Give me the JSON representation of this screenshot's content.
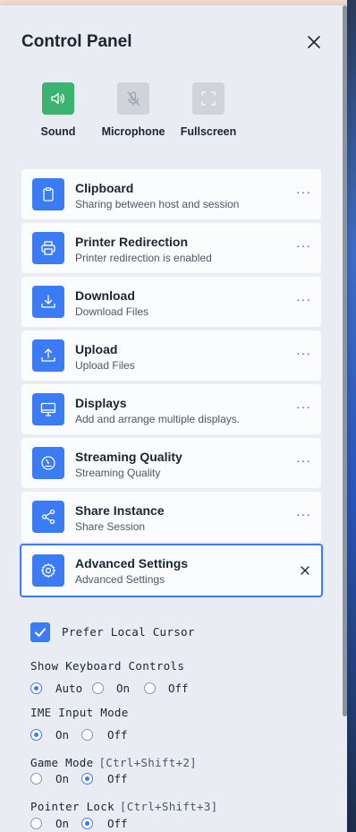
{
  "panel": {
    "title": "Control Panel"
  },
  "quick_actions": [
    {
      "label": "Sound",
      "icon": "speaker-icon",
      "active": true
    },
    {
      "label": "Microphone",
      "icon": "microphone-muted-icon",
      "active": false
    },
    {
      "label": "Fullscreen",
      "icon": "fullscreen-icon",
      "active": false
    }
  ],
  "items": [
    {
      "title": "Clipboard",
      "subtitle": "Sharing between host and session",
      "icon": "clipboard-icon"
    },
    {
      "title": "Printer Redirection",
      "subtitle": "Printer redirection is enabled",
      "icon": "printer-icon"
    },
    {
      "title": "Download",
      "subtitle": "Download Files",
      "icon": "download-icon"
    },
    {
      "title": "Upload",
      "subtitle": "Upload Files",
      "icon": "upload-icon"
    },
    {
      "title": "Displays",
      "subtitle": "Add and arrange multiple displays.",
      "icon": "monitor-icon"
    },
    {
      "title": "Streaming Quality",
      "subtitle": "Streaming Quality",
      "icon": "speedometer-icon"
    },
    {
      "title": "Share Instance",
      "subtitle": "Share Session",
      "icon": "share-icon"
    },
    {
      "title": "Advanced Settings",
      "subtitle": "Advanced Settings",
      "icon": "gear-icon"
    }
  ],
  "more_label": "···",
  "advanced": {
    "prefer_local_cursor": {
      "label": "Prefer Local Cursor",
      "checked": true
    },
    "keyboard_controls": {
      "label": "Show Keyboard Controls",
      "options": [
        "Auto",
        "On",
        "Off"
      ],
      "selected": "Auto"
    },
    "ime_input_mode": {
      "label": "IME Input Mode",
      "options": [
        "On",
        "Off"
      ],
      "selected": "On"
    },
    "game_mode": {
      "label": "Game Mode",
      "hotkey": "[Ctrl+Shift+2]",
      "options": [
        "On",
        "Off"
      ],
      "selected": "Off"
    },
    "pointer_lock": {
      "label": "Pointer Lock",
      "hotkey": "[Ctrl+Shift+3]",
      "options": [
        "On",
        "Off"
      ],
      "selected": "Off"
    }
  },
  "colors": {
    "accent": "#3b7cf6",
    "sound_active": "#3cb371",
    "inactive_button": "#d0d4da"
  }
}
